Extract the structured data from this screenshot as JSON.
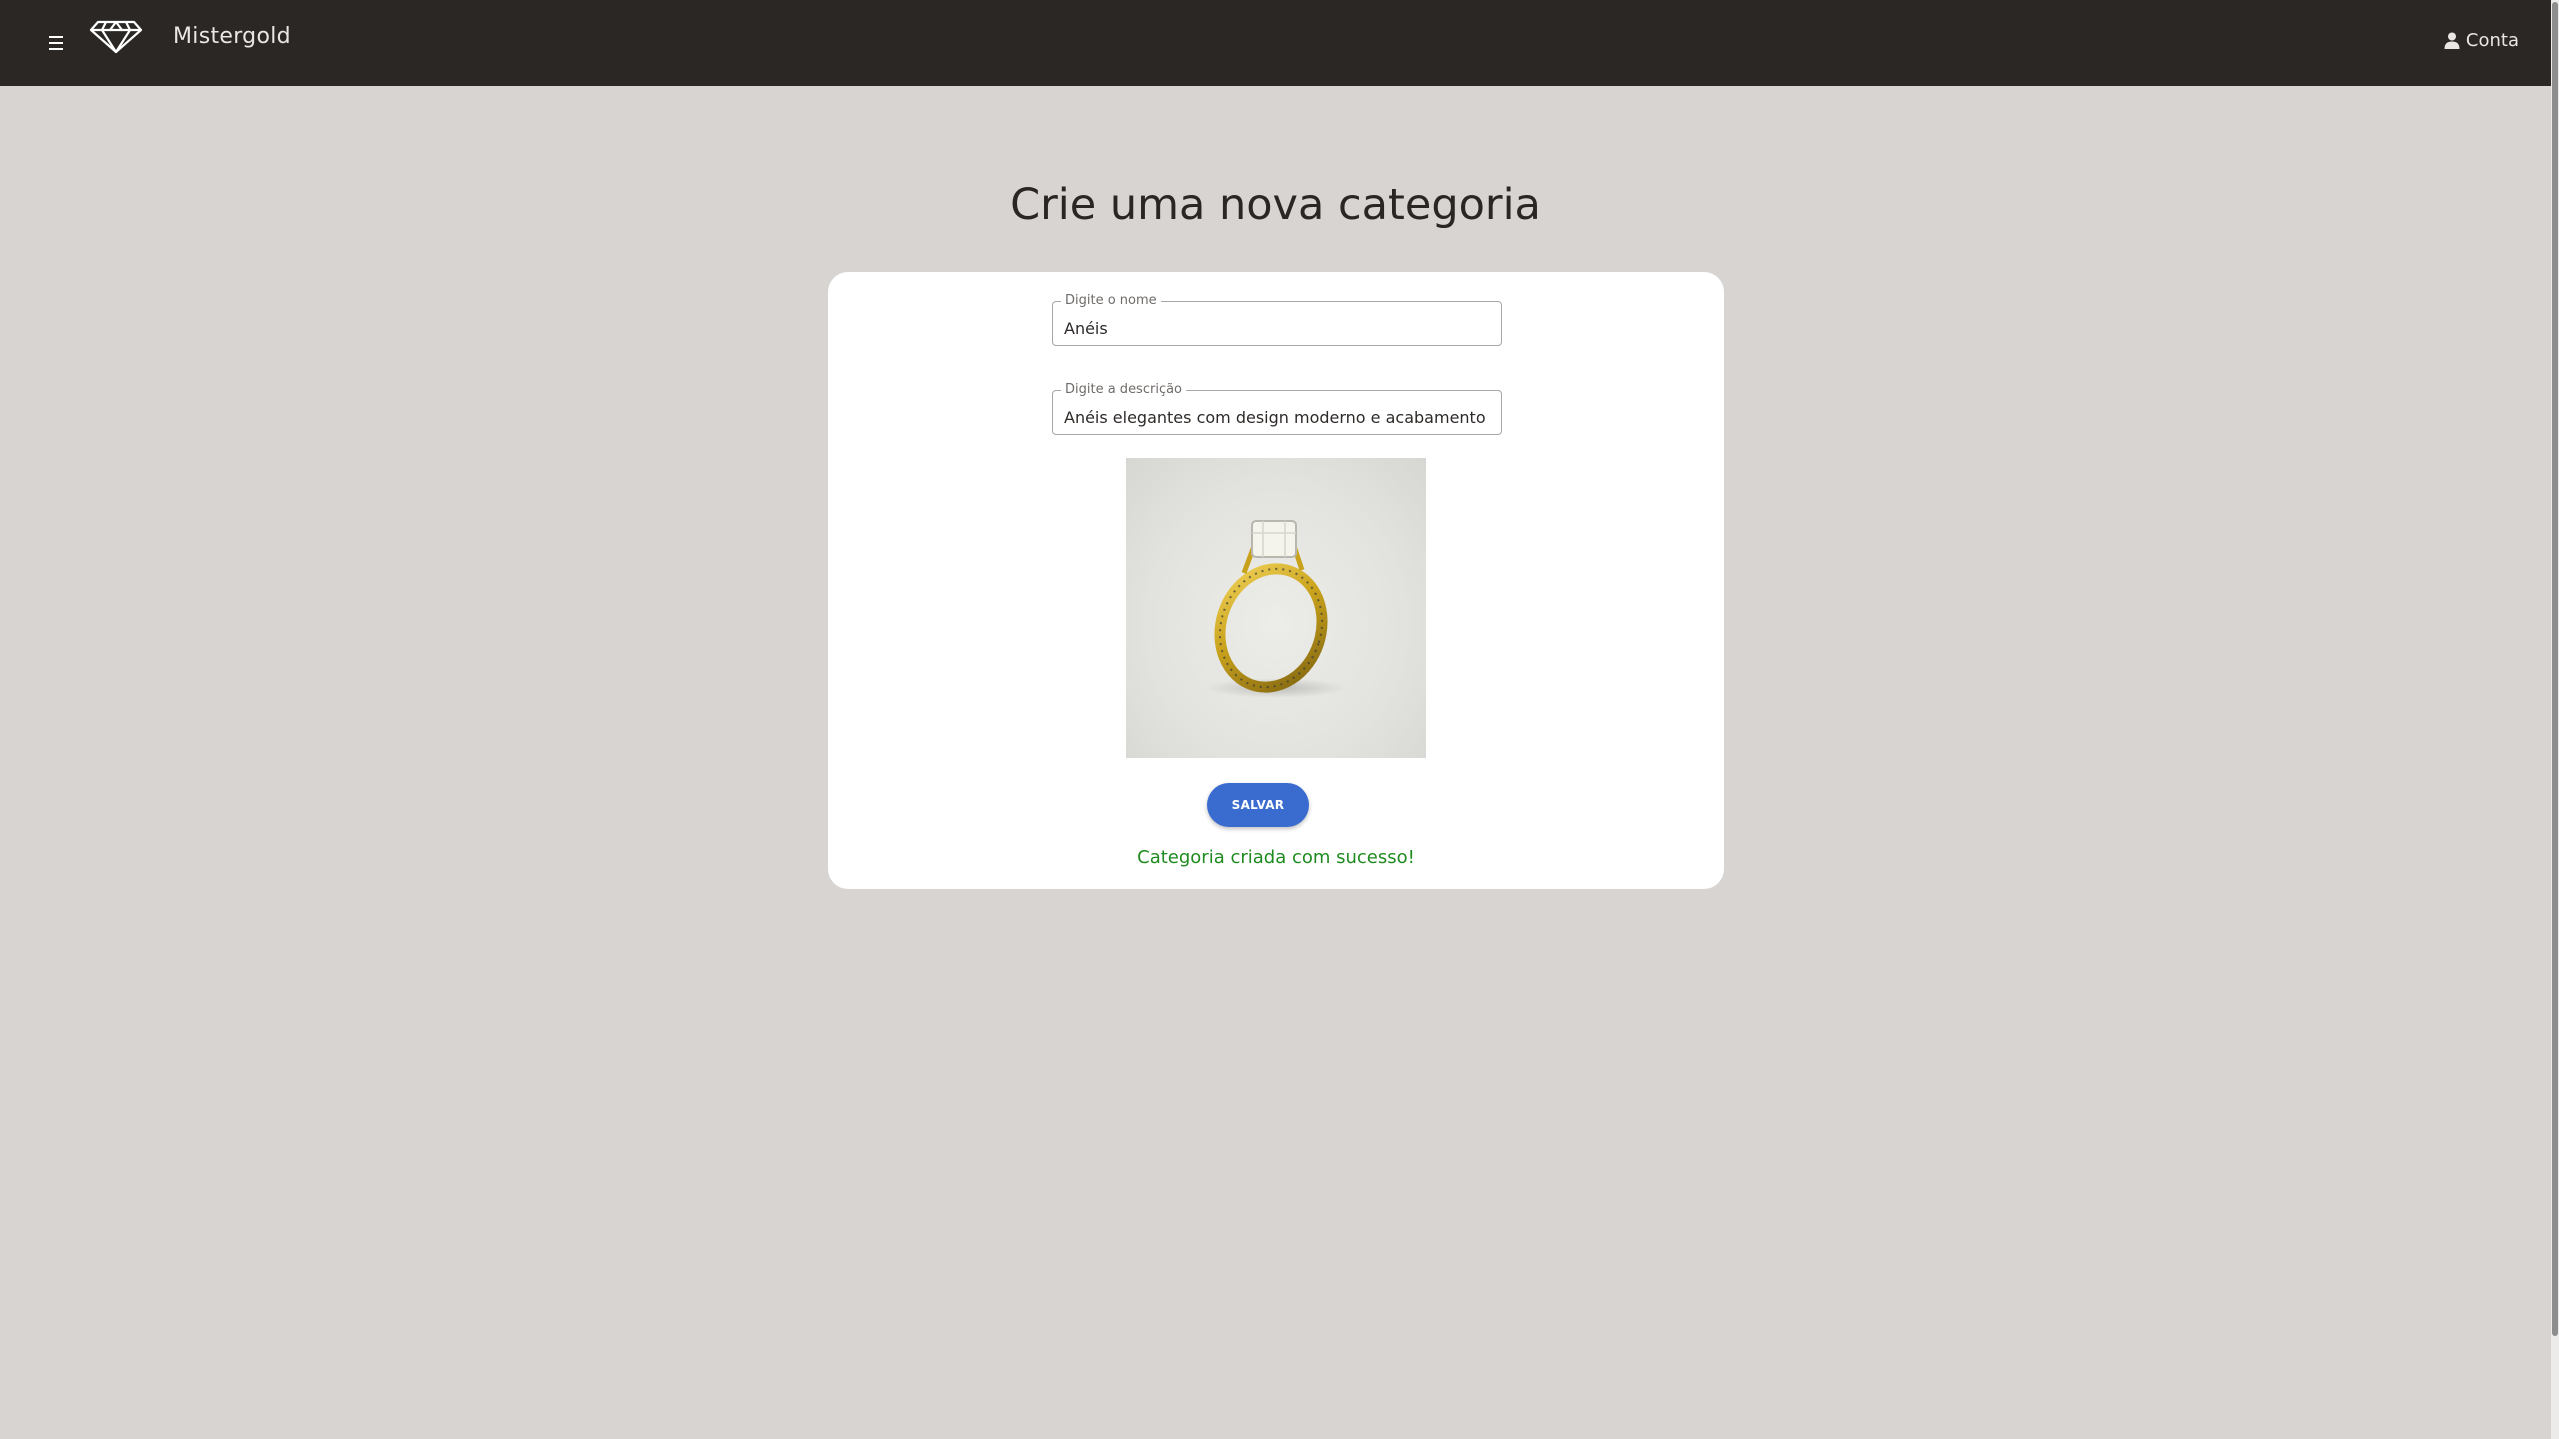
{
  "header": {
    "brand": "Mistergold",
    "account_label": "Conta",
    "menu_icon": "hamburger-menu-icon",
    "logo_icon": "diamond-logo-icon",
    "account_icon": "user-icon"
  },
  "main": {
    "title": "Crie uma nova categoria",
    "name_field": {
      "label": "Digite o nome",
      "value": "Anéis"
    },
    "description_field": {
      "label": "Digite a descrição",
      "value": "Anéis elegantes com design moderno e acabamento"
    },
    "image_alt": "gold-ring-image",
    "save_label": "SALVAR",
    "success_message": "Categoria criada com sucesso!"
  },
  "colors": {
    "header_bg": "#2b2725",
    "page_bg": "#d8d4d1",
    "primary_button": "#3a6cd0",
    "success_text": "#1f8a1f"
  }
}
